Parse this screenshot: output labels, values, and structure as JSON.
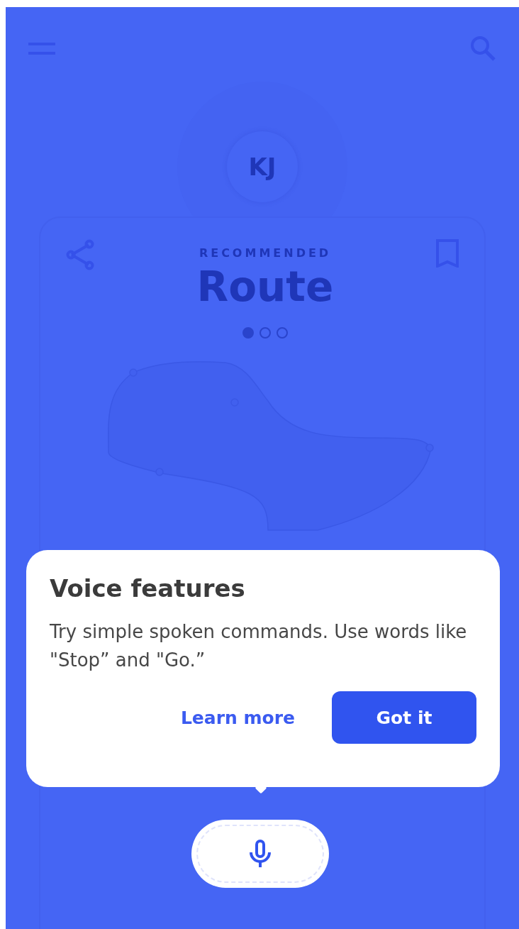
{
  "header": {
    "avatar_initials": "KJ"
  },
  "card": {
    "label": "RECOMMENDED",
    "title": "Route",
    "page_dots": [
      {
        "selected": true
      },
      {
        "selected": false
      },
      {
        "selected": false
      }
    ]
  },
  "dialog": {
    "title": "Voice features",
    "body": "Try simple spoken commands. Use words like \"Stop” and \"Go.”",
    "buttons": [
      {
        "label": "Learn more",
        "kind": "text"
      },
      {
        "label": "Got it",
        "kind": "filled"
      }
    ]
  }
}
